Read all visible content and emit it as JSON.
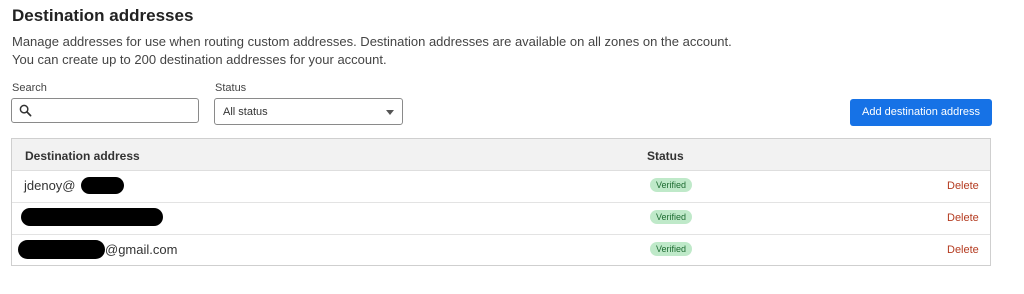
{
  "header": {
    "title": "Destination addresses",
    "description_line1": "Manage addresses for use when routing custom addresses. Destination addresses are available on all zones on the account.",
    "description_line2": "You can create up to 200 destination addresses for your account."
  },
  "filters": {
    "search_label": "Search",
    "search_value": "",
    "search_icon": "search-icon",
    "status_label": "Status",
    "status_selected": "All status"
  },
  "actions": {
    "add_label": "Add destination address"
  },
  "table": {
    "columns": [
      "Destination address",
      "Status"
    ],
    "rows": [
      {
        "address": "jdenoy@",
        "status": "Verified",
        "action": "Delete"
      },
      {
        "address": "",
        "status": "Verified",
        "action": "Delete"
      },
      {
        "address": "@gmail.com",
        "status": "Verified",
        "action": "Delete"
      }
    ]
  },
  "colors": {
    "primary_button": "#1672e6",
    "verified_badge_bg": "#bfe9c9",
    "verified_badge_text": "#1d6b31",
    "delete_link": "#b43b20"
  }
}
